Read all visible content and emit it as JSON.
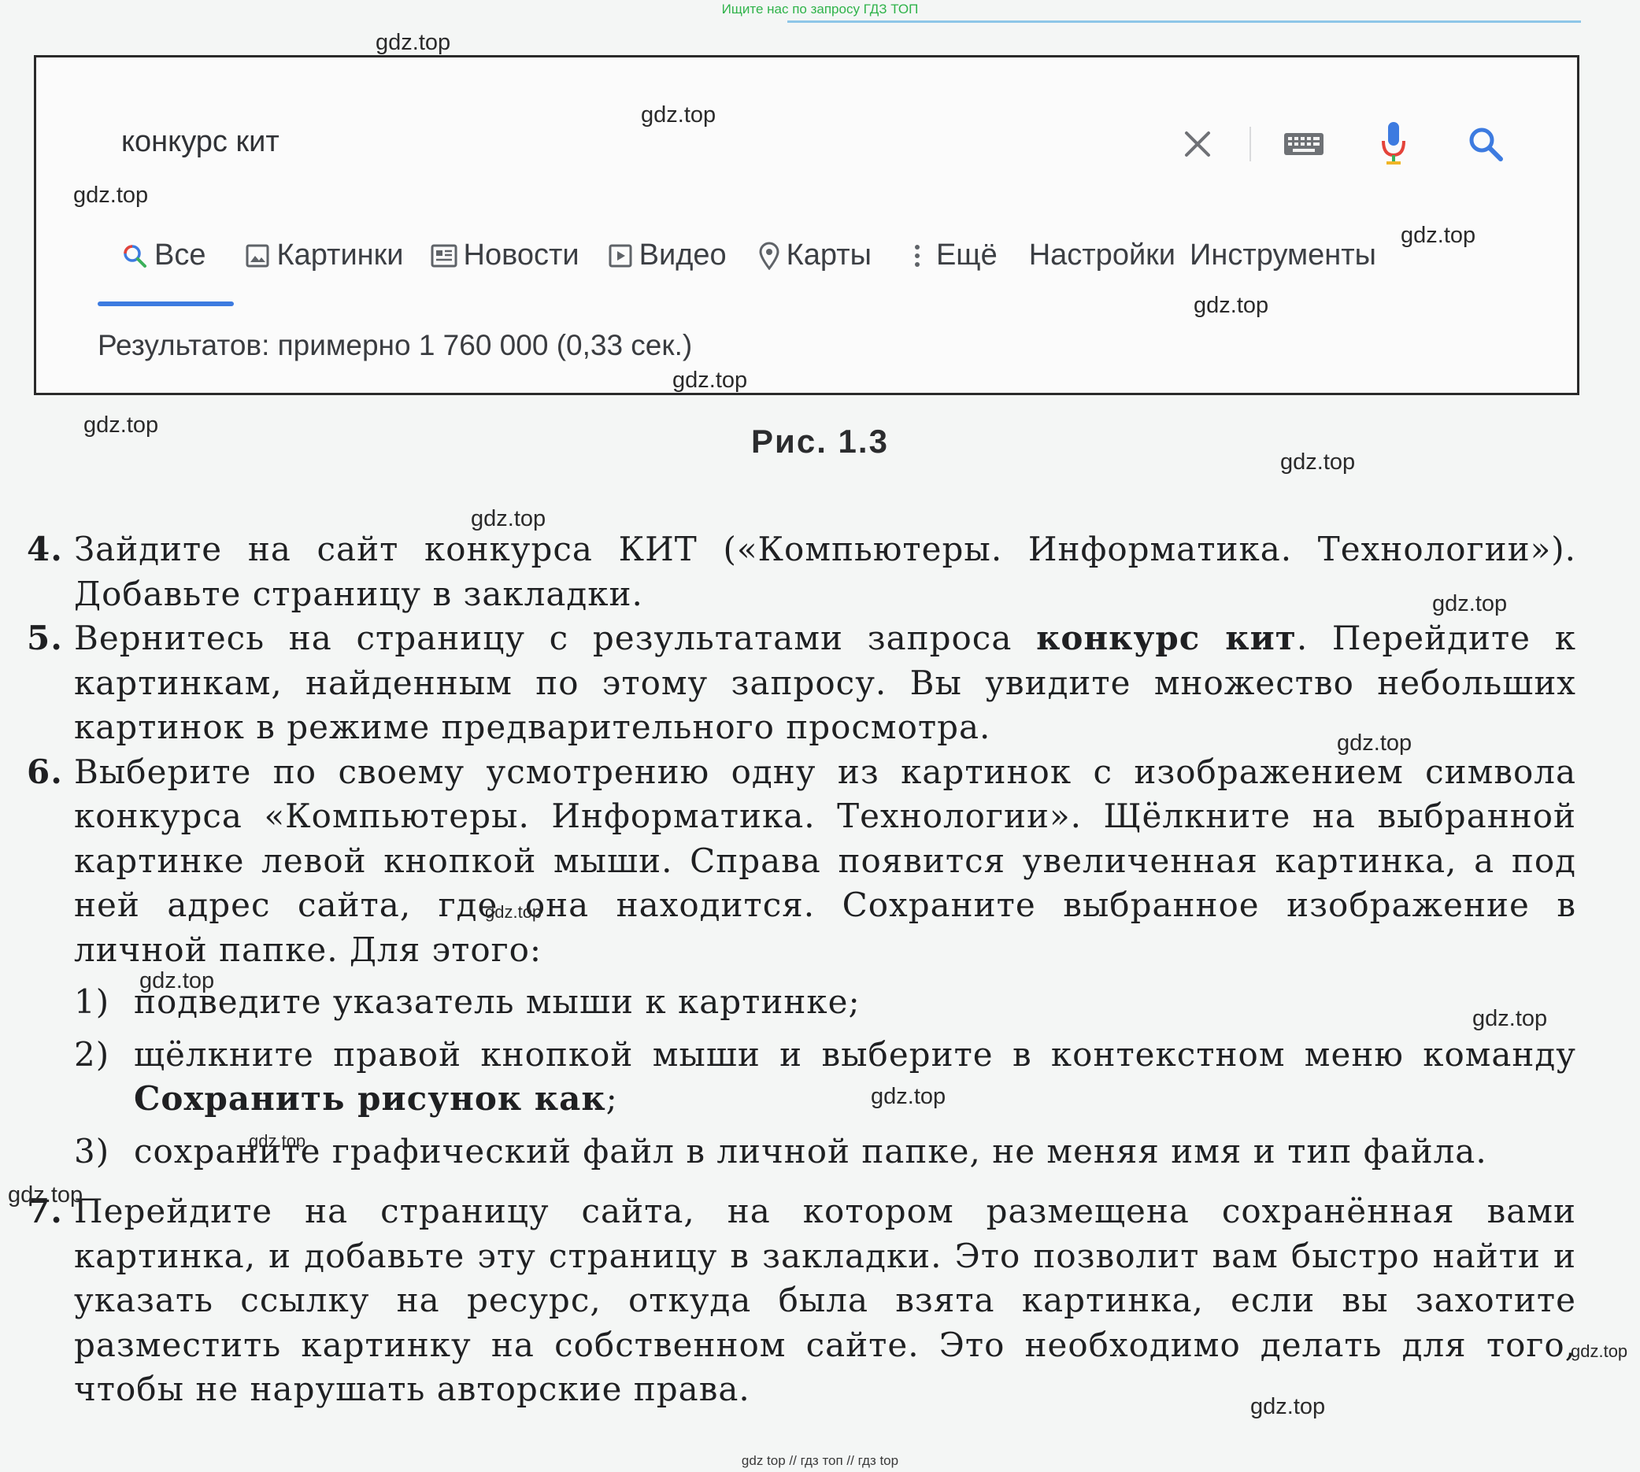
{
  "banner": "Ищите нас по запросу ГДЗ ТОП",
  "search": {
    "query": "конкурс кит",
    "tabs": [
      {
        "label": "Все",
        "icon": "search-icon"
      },
      {
        "label": "Картинки",
        "icon": "image-icon"
      },
      {
        "label": "Новости",
        "icon": "news-icon"
      },
      {
        "label": "Видео",
        "icon": "video-icon"
      },
      {
        "label": "Карты",
        "icon": "map-pin-icon"
      },
      {
        "label": "Ещё",
        "icon": "more-vert-icon"
      },
      {
        "label": "Настройки",
        "icon": ""
      },
      {
        "label": "Инструменты",
        "icon": ""
      }
    ],
    "results_count": "Результатов: примерно 1 760 000 (0,33 сек.)",
    "colors": {
      "accent": "#3d7be0",
      "mic_red": "#e4433a",
      "mic_blue": "#3d7be0"
    }
  },
  "figure_caption": "Рис. 1.3",
  "steps": {
    "s4": {
      "num": "4.",
      "text": "Зайдите на сайт конкурса КИТ («Компьютеры. Информатика. Технологии»). Добавьте страницу в закладки."
    },
    "s5": {
      "num": "5.",
      "text_before": "Вернитесь на страницу с результатами запроса ",
      "bold": "конкурс кит",
      "text_after": ". Перейдите к картинкам, найденным по этому запросу. Вы увидите множество небольших картинок в режиме предварительного просмотра."
    },
    "s6": {
      "num": "6.",
      "text": "Выберите по своему усмотрению одну из картинок с изображением символа конкурса «Компьютеры. Информатика. Технологии». Щёлкните на выбранной картинке левой кнопкой мыши. Справа появится увеличенная картинка, а под ней адрес сайта, где она находится. Сохраните выбранное изображение в личной папке. Для этого:"
    },
    "s6_1": {
      "num": "1)",
      "text": "подведите указатель мыши к картинке;"
    },
    "s6_2": {
      "num": "2)",
      "text_before": "щёлкните правой кнопкой мыши и выберите в контекстном меню команду ",
      "bold": "Сохранить рисунок как",
      "text_after": ";"
    },
    "s6_3": {
      "num": "3)",
      "text": "сохраните графический файл в личной папке, не меняя имя и тип файла."
    },
    "s7": {
      "num": "7.",
      "text": "Перейдите на страницу сайта, на котором размещена сохранённая вами картинка, и добавьте эту страницу в закладки. Это позволит вам быстро найти и указать ссылку на ресурс, откуда была взята картинка, если вы захотите разместить картинку на собственном сайте. Это необходимо делать для того, чтобы не нарушать авторские права."
    }
  },
  "watermark": "gdz.top",
  "footer": "gdz top // гдз топ // гдз top"
}
